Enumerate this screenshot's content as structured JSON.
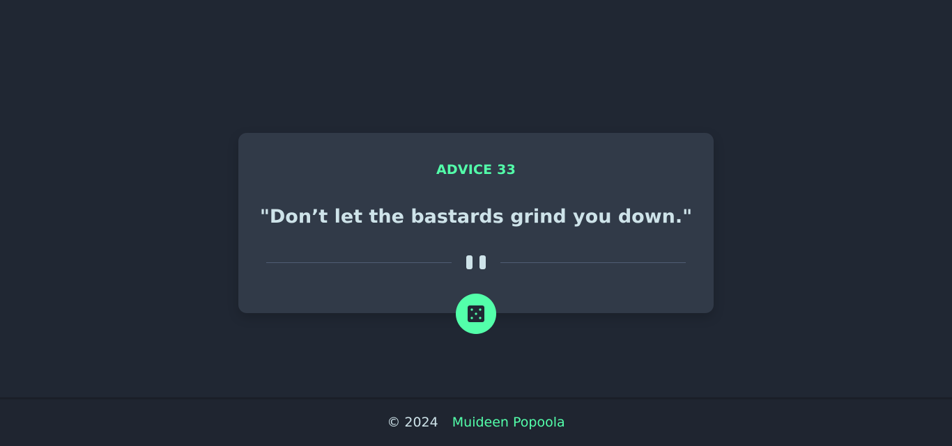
{
  "card": {
    "advice_label": "ADVICE 33",
    "advice_text": "\"Don’t let the bastards grind you down.\""
  },
  "divider": {
    "icon": "pause-icon"
  },
  "action": {
    "icon": "dice-icon"
  },
  "footer": {
    "copyright": "© 2024",
    "author": "Muideen Popoola"
  },
  "colors": {
    "background": "#202733",
    "card": "#313a48",
    "accent": "#53ffaa",
    "text": "#cee3e9"
  }
}
